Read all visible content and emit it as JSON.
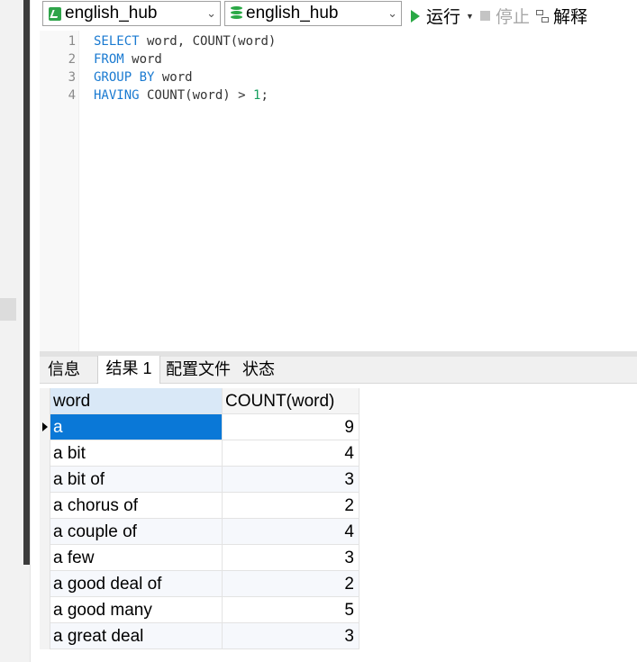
{
  "toolbar": {
    "connection": "english_hub",
    "database": "english_hub",
    "run_label": "运行",
    "stop_label": "停止",
    "explain_label": "解释"
  },
  "editor": {
    "lines": [
      {
        "num": "1",
        "kw1": "SELECT",
        "rest": " word, COUNT(word)"
      },
      {
        "num": "2",
        "kw1": "FROM",
        "rest": " word"
      },
      {
        "num": "3",
        "kw1": "GROUP BY",
        "rest": " word"
      },
      {
        "num": "4",
        "kw1": "HAVING",
        "rest": " COUNT(word) > ",
        "num_lit": "1",
        "end": ";"
      }
    ]
  },
  "tabs": [
    "信息",
    "结果 1",
    "配置文件",
    "状态"
  ],
  "active_tab": "结果 1",
  "result": {
    "columns": [
      "word",
      "COUNT(word)"
    ],
    "rows": [
      {
        "word": "a",
        "count": "9"
      },
      {
        "word": "a bit",
        "count": "4"
      },
      {
        "word": "a bit of",
        "count": "3"
      },
      {
        "word": "a chorus of",
        "count": "2"
      },
      {
        "word": "a couple of",
        "count": "4"
      },
      {
        "word": "a few",
        "count": "3"
      },
      {
        "word": "a good deal of",
        "count": "2"
      },
      {
        "word": "a good many",
        "count": "5"
      },
      {
        "word": "a great deal",
        "count": "3"
      }
    ]
  },
  "colors": {
    "selection": "#0a78d7",
    "keyword": "#1a7ad1",
    "run_icon": "#2aa845"
  }
}
